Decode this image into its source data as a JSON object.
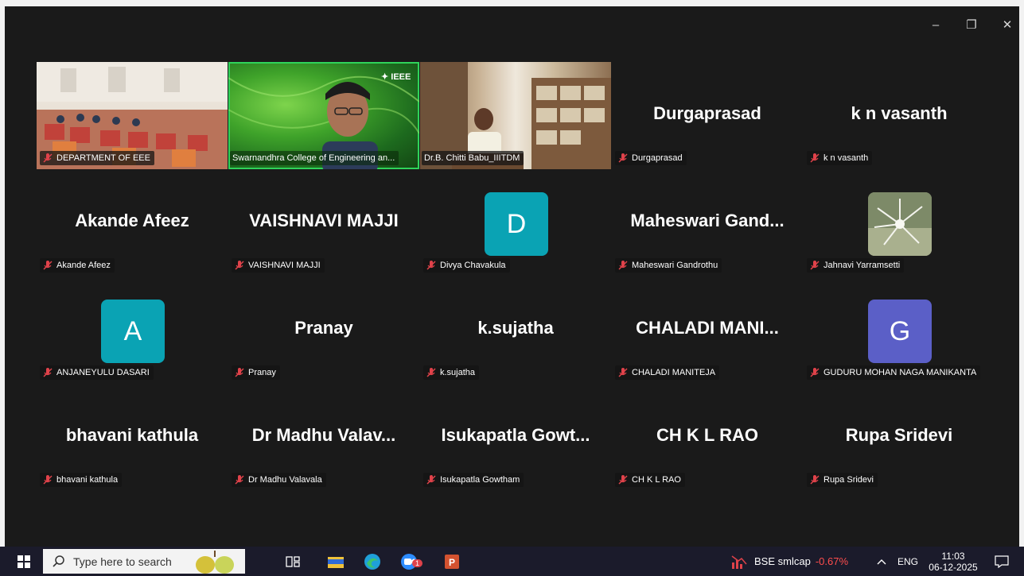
{
  "window_controls": {
    "minimize": "–",
    "restore": "❐",
    "close": "✕"
  },
  "video_tiles": [
    {
      "label": "DEPARTMENT OF EEE",
      "speaking": false,
      "scene": "classroom"
    },
    {
      "label": "Swarnandhra College of Engineering an...",
      "speaking": true,
      "scene": "green",
      "overlay_text": "✦ IEEE"
    },
    {
      "label": "Dr.B. Chitti Babu_IIITDM",
      "speaking": false,
      "scene": "office"
    }
  ],
  "participants_row1": [
    {
      "display": "Durgaprasad",
      "label": "Durgaprasad"
    },
    {
      "display": "k n vasanth",
      "label": "k n vasanth"
    }
  ],
  "participants_row2": [
    {
      "display": "Akande Afeez",
      "label": "Akande Afeez"
    },
    {
      "display": "VAISHNAVI MAJJI",
      "label": "VAISHNAVI MAJJI"
    },
    {
      "avatar_letter": "D",
      "avatar_color": "#0aa3b4",
      "label": "Divya Chavakula"
    },
    {
      "display": "Maheswari  Gand...",
      "label": "Maheswari Gandrothu"
    },
    {
      "photo": "flower",
      "label": "Jahnavi Yarramsetti"
    }
  ],
  "participants_row3": [
    {
      "avatar_letter": "A",
      "avatar_color": "#0aa3b4",
      "label": "ANJANEYULU DASARI"
    },
    {
      "display": "Pranay",
      "label": "Pranay"
    },
    {
      "display": "k.sujatha",
      "label": "k.sujatha"
    },
    {
      "display": "CHALADI  MANI...",
      "label": "CHALADI MANITEJA"
    },
    {
      "avatar_letter": "G",
      "avatar_color": "#5b5fc7",
      "label": "GUDURU MOHAN NAGA MANIKANTA"
    }
  ],
  "participants_row4": [
    {
      "display": "bhavani kathula",
      "label": "bhavani kathula"
    },
    {
      "display": "Dr Madhu Valav...",
      "label": "Dr Madhu Valavala"
    },
    {
      "display": "Isukapatla  Gowt...",
      "label": "Isukapatla Gowtham"
    },
    {
      "display": "CH K L RAO",
      "label": "CH K L RAO"
    },
    {
      "display": "Rupa Sridevi",
      "label": "Rupa Sridevi"
    }
  ],
  "taskbar": {
    "search_placeholder": "Type here to search",
    "stock_name": "BSE smlcap",
    "stock_change": "-0.67%",
    "stock_change_color": "#ff4d4d",
    "language": "ENG",
    "time": "11:03",
    "date": "06-12-2025",
    "zoom_badge": "1"
  },
  "colors": {
    "background": "#1a1a1a",
    "speaking_outline": "#2fd35a",
    "mic_muted": "#e0424a"
  }
}
